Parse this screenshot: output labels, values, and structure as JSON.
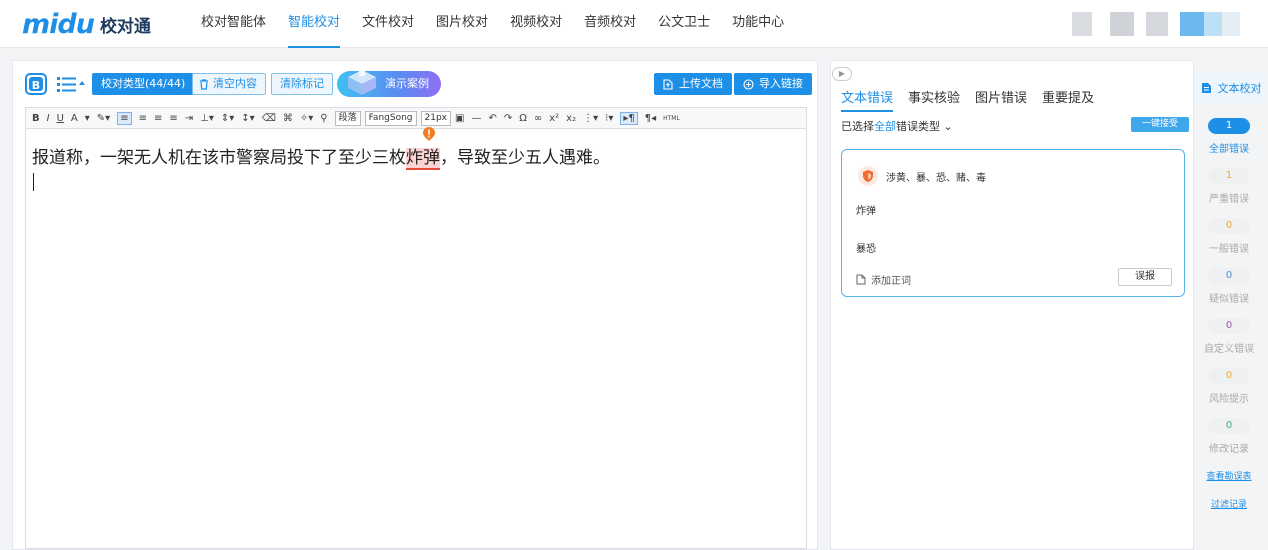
{
  "app": {
    "logo_mark": "midu",
    "logo_text": "校对通"
  },
  "nav": [
    "校对智能体",
    "智能校对",
    "文件校对",
    "图片校对",
    "视频校对",
    "音频校对",
    "公文卫士",
    "功能中心"
  ],
  "editor": {
    "buttons": {
      "type": "校对类型(44/44)",
      "clear": "清空内容",
      "clear_marks": "清除标记",
      "demo": "演示案例",
      "upload": "上传文档",
      "import_link": "导入链接"
    },
    "toolbar": {
      "bold": "B",
      "italic": "I",
      "underline": "U",
      "font_color": "A",
      "para": "段落",
      "font": "FangSong",
      "size": "21px",
      "html": "HTML"
    },
    "text_before": "报道称，一架无人机在该市警察局投下了至少三枚",
    "highlight": "炸弹",
    "text_after": "，导致至少五人遇难。"
  },
  "panel": {
    "tabs": [
      "文本错误",
      "事实核验",
      "图片错误",
      "重要提及"
    ],
    "filter_prefix": "已选择",
    "filter_all": "全部",
    "filter_suffix": "错误类型",
    "onekey": "一键接受",
    "card": {
      "categories": "涉黄、暴、恐、赌、毒",
      "word": "炸弹",
      "type": "暴恐",
      "add_word": "添加正词",
      "report": "误报"
    }
  },
  "side": {
    "title": "文本校对",
    "stats": [
      {
        "count": "1",
        "label": "全部错误"
      },
      {
        "count": "1",
        "label": "严重错误"
      },
      {
        "count": "0",
        "label": "一般错误"
      },
      {
        "count": "0",
        "label": "疑似错误"
      },
      {
        "count": "0",
        "label": "自定义错误"
      },
      {
        "count": "0",
        "label": "风险提示"
      },
      {
        "count": "0",
        "label": "修改记录"
      }
    ],
    "link_report": "查看勘误表",
    "link_filter": "过滤记录"
  },
  "colors": {
    "accent": "#1e8fe6",
    "danger": "#e74c3c"
  }
}
